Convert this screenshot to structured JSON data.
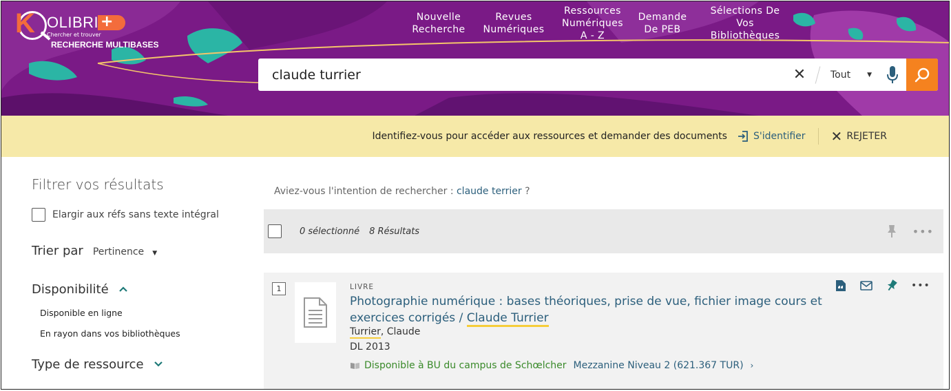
{
  "brand": {
    "logo_k": "K",
    "logo_word": "OLIBRIS",
    "logo_plus": "+",
    "tagline": "Chercher et trouver",
    "subtitle": "RECHERCHE MULTIBASES"
  },
  "nav": [
    {
      "label": "Nouvelle Recherche"
    },
    {
      "label": "Revues Numériques"
    },
    {
      "label": "Ressources Numériques A - Z"
    },
    {
      "label": "Demande De PEB"
    },
    {
      "label": "Sélections De Vos Bibliothèques"
    }
  ],
  "search": {
    "query": "claude turrier",
    "scope": "Tout",
    "icons": {
      "clear": "close-icon",
      "caret": "caret-down-icon",
      "mic": "microphone-icon",
      "submit": "search-icon"
    }
  },
  "banner": {
    "message": "Identifiez-vous pour accéder aux ressources et demander des documents",
    "login": "S'identifier",
    "dismiss": "REJETER"
  },
  "filters": {
    "title": "Filtrer vos résultats",
    "expand_label": "Elargir aux réfs sans texte intégral",
    "sort_label": "Trier par",
    "sort_value": "Pertinence",
    "availability": {
      "label": "Disponibilité",
      "items": [
        "Disponible en ligne",
        "En rayon dans vos bibliothèques"
      ]
    },
    "resource_type": {
      "label": "Type de ressource"
    }
  },
  "did_you_mean": {
    "prefix": "Aviez-vous l'intention de rechercher :",
    "suggestion": "claude terrier",
    "suffix": "?"
  },
  "results_bar": {
    "selected": "0 sélectionné",
    "count": "8 Résultats"
  },
  "results": [
    {
      "number": "1",
      "type": "LIVRE",
      "title_prefix": "Photographie numérique : bases théoriques, prise de vue, fichier image cours et exercices corrigés / ",
      "title_author": "Claude Turrier",
      "author_last": "Turrier",
      "author_first": ", Claude",
      "date": "DL 2013",
      "availability": "Disponible à BU du campus de Schœlcher",
      "location": "Mezzanine Niveau 2 (621.367 TUR)"
    }
  ],
  "colors": {
    "header": "#7a1a86",
    "accent": "#f5821f",
    "banner": "#f6e9a8",
    "link": "#2c5f7c",
    "teal": "#1e7a78",
    "available": "#3a8a2a",
    "highlight": "#f6cd3a"
  }
}
